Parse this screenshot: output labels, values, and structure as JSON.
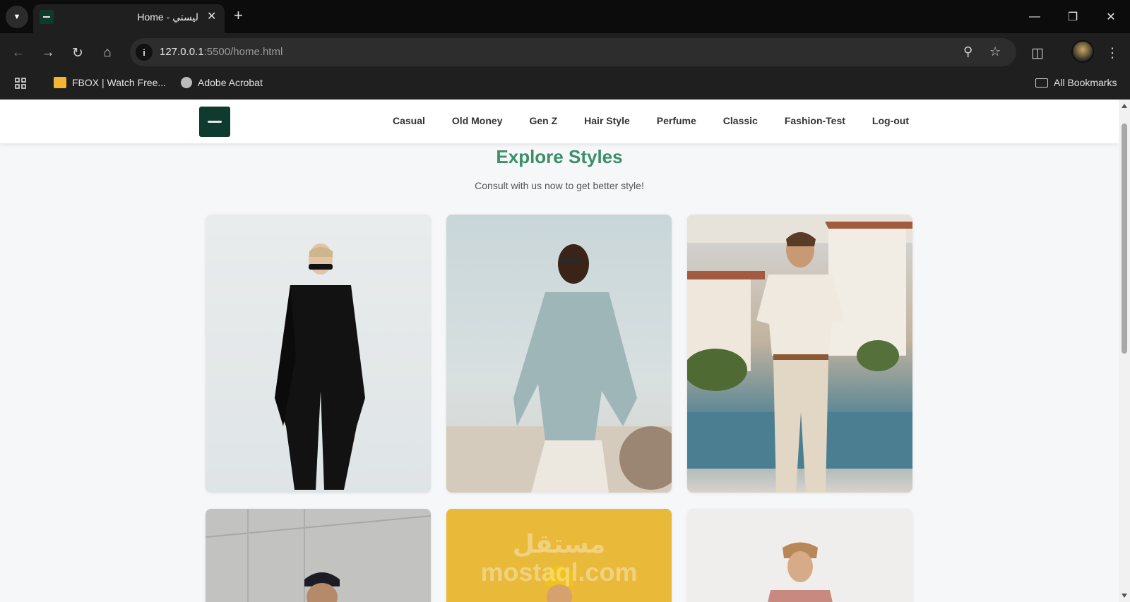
{
  "browser": {
    "tab_title": "Home - ليستي",
    "url_host": "127.0.0.1",
    "url_rest": ":5500/home.html",
    "bookmarks": [
      {
        "label": "FBOX | Watch Free..."
      },
      {
        "label": "Adobe Acrobat"
      }
    ],
    "all_bookmarks_label": "All Bookmarks"
  },
  "site": {
    "nav": [
      "Casual",
      "Old Money",
      "Gen Z",
      "Hair Style",
      "Perfume",
      "Classic",
      "Fashion-Test",
      "Log-out"
    ],
    "hero_title": "Explore Styles",
    "hero_subtitle": "Consult with us now to get better style!",
    "brand_color": "#3d8f68",
    "logo_bg": "#0f3a2e",
    "watermark": "مستقل mostaql.com"
  }
}
